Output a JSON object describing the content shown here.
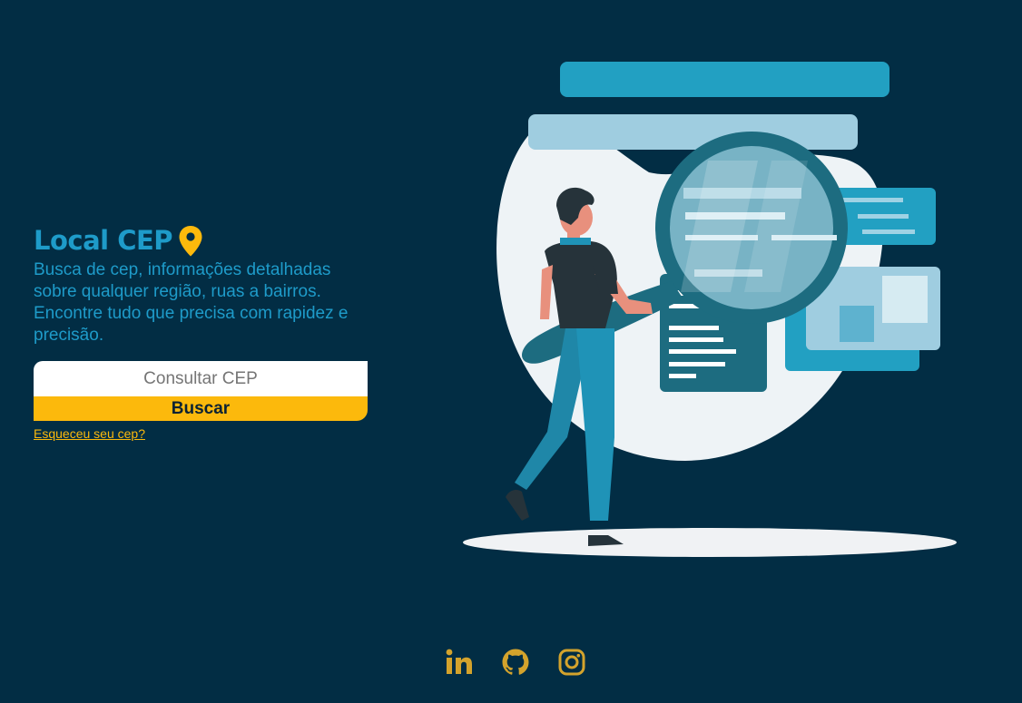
{
  "header": {
    "title": "Local CEP",
    "title_icon": "map-pin-icon",
    "description": "Busca de cep, informações detalhadas sobre qualquer região, ruas a bairros. Encontre tudo que precisa com rapidez e precisão."
  },
  "search": {
    "placeholder": "Consultar CEP",
    "value": "",
    "button_label": "Buscar",
    "forgot_link": "Esqueceu seu cep?"
  },
  "illustration": {
    "icon": "person-magnifying-glass-illustration"
  },
  "social": [
    {
      "name": "linkedin-icon"
    },
    {
      "name": "github-icon"
    },
    {
      "name": "instagram-icon"
    }
  ],
  "colors": {
    "background": "#022d44",
    "accent_blue": "#1e9bc9",
    "accent_yellow": "#fcb90c"
  }
}
